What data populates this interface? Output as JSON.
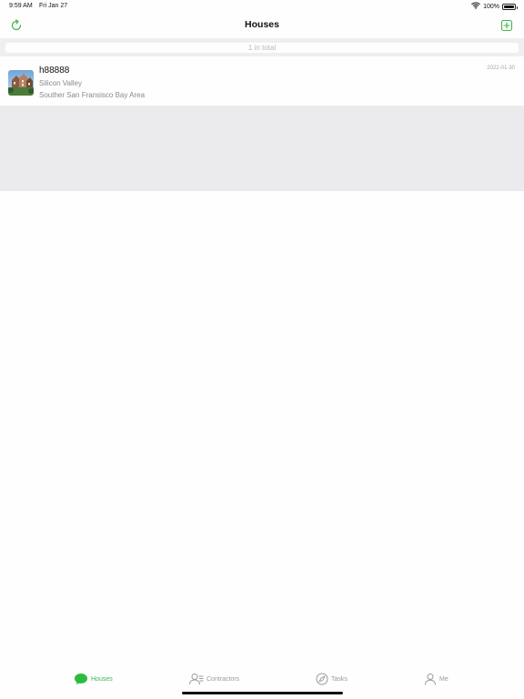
{
  "status": {
    "time": "9:59 AM",
    "date": "Fri Jan 27",
    "battery": "100%"
  },
  "nav": {
    "title": "Houses",
    "left_icon": "refresh-icon",
    "right_icon": "add-icon"
  },
  "list": {
    "total_text": "1 in total",
    "items": [
      {
        "title": "h88888",
        "line1": "Silicon Valley",
        "line2": "Souther San Fransisco Bay Area",
        "date": "2022-01-30",
        "thumbnail": "house-photo"
      }
    ]
  },
  "tabs": [
    {
      "label": "Houses",
      "icon": "chat-bubble-icon",
      "active": true
    },
    {
      "label": "Contractors",
      "icon": "contractors-icon",
      "active": false
    },
    {
      "label": "Tasks",
      "icon": "compass-icon",
      "active": false
    },
    {
      "label": "Me",
      "icon": "person-icon",
      "active": false
    }
  ],
  "colors": {
    "accent": "#3fb54a",
    "inactive": "#9a9aa0",
    "band": "#efeff0"
  }
}
